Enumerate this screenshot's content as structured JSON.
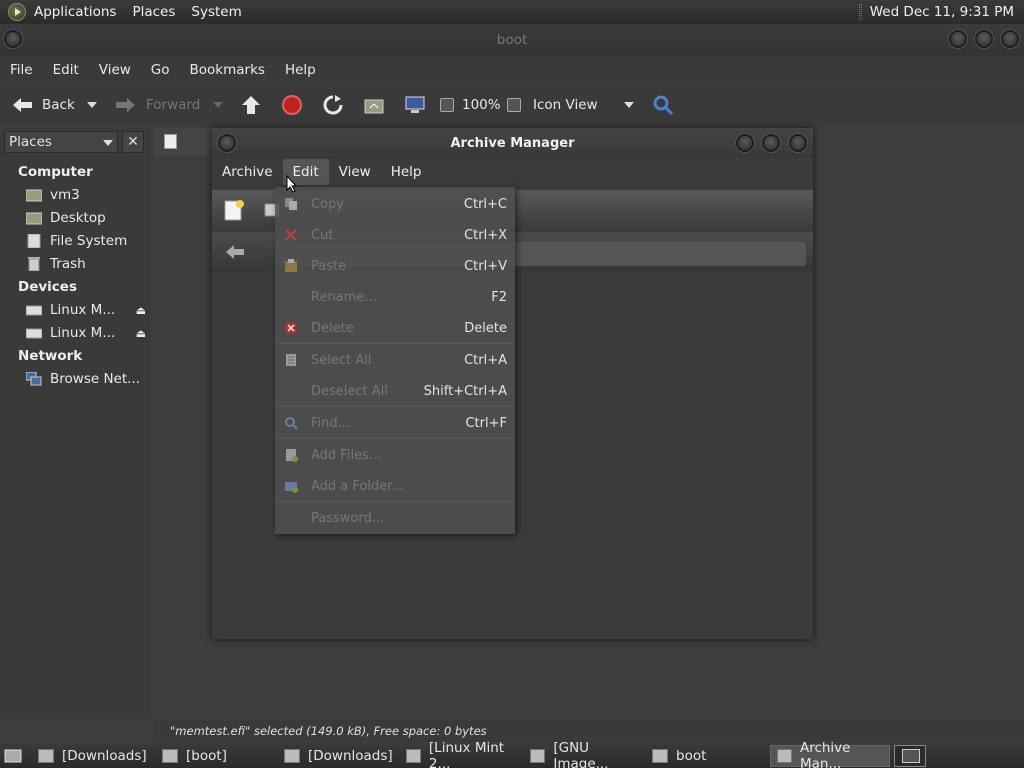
{
  "top_panel": {
    "menus": [
      "Applications",
      "Places",
      "System"
    ],
    "clock": "Wed Dec 11,  9:31 PM"
  },
  "file_manager": {
    "title": "boot",
    "menus": [
      "File",
      "Edit",
      "View",
      "Go",
      "Bookmarks",
      "Help"
    ],
    "toolbar": {
      "back": "Back",
      "forward": "Forward",
      "zoom": "100%",
      "view_mode": "Icon View"
    },
    "sidebar": {
      "header": "Places",
      "sections": {
        "computer": "Computer",
        "devices": "Devices",
        "network": "Network"
      },
      "computer_items": [
        "vm3",
        "Desktop",
        "File System",
        "Trash"
      ],
      "device_items": [
        "Linux M...",
        "Linux M..."
      ],
      "network_items": [
        "Browse Net..."
      ]
    },
    "status": "\"memtest.efi\" selected (149.0 kB), Free space: 0 bytes"
  },
  "archive_manager": {
    "title": "Archive Manager",
    "menus": [
      "Archive",
      "Edit",
      "View",
      "Help"
    ],
    "edit_menu": [
      {
        "label": "Copy",
        "accel": "Ctrl+C",
        "enabled": false
      },
      {
        "label": "Cut",
        "accel": "Ctrl+X",
        "enabled": false
      },
      {
        "label": "Paste",
        "accel": "Ctrl+V",
        "enabled": false
      },
      {
        "label": "Rename...",
        "accel": "F2",
        "enabled": false
      },
      {
        "label": "Delete",
        "accel": "Delete",
        "enabled": false
      },
      {
        "label": "Select All",
        "accel": "Ctrl+A",
        "enabled": false
      },
      {
        "label": "Deselect All",
        "accel": "Shift+Ctrl+A",
        "enabled": false
      },
      {
        "label": "Find...",
        "accel": "Ctrl+F",
        "enabled": false
      },
      {
        "label": "Add Files...",
        "accel": "",
        "enabled": false
      },
      {
        "label": "Add a Folder...",
        "accel": "",
        "enabled": false
      },
      {
        "label": "Password...",
        "accel": "",
        "enabled": false
      }
    ]
  },
  "taskbar": {
    "tasks": [
      "[Downloads]",
      "[boot]",
      "[Downloads]",
      "[Linux Mint 2...",
      "[GNU Image...",
      "boot",
      "Archive Man..."
    ]
  }
}
